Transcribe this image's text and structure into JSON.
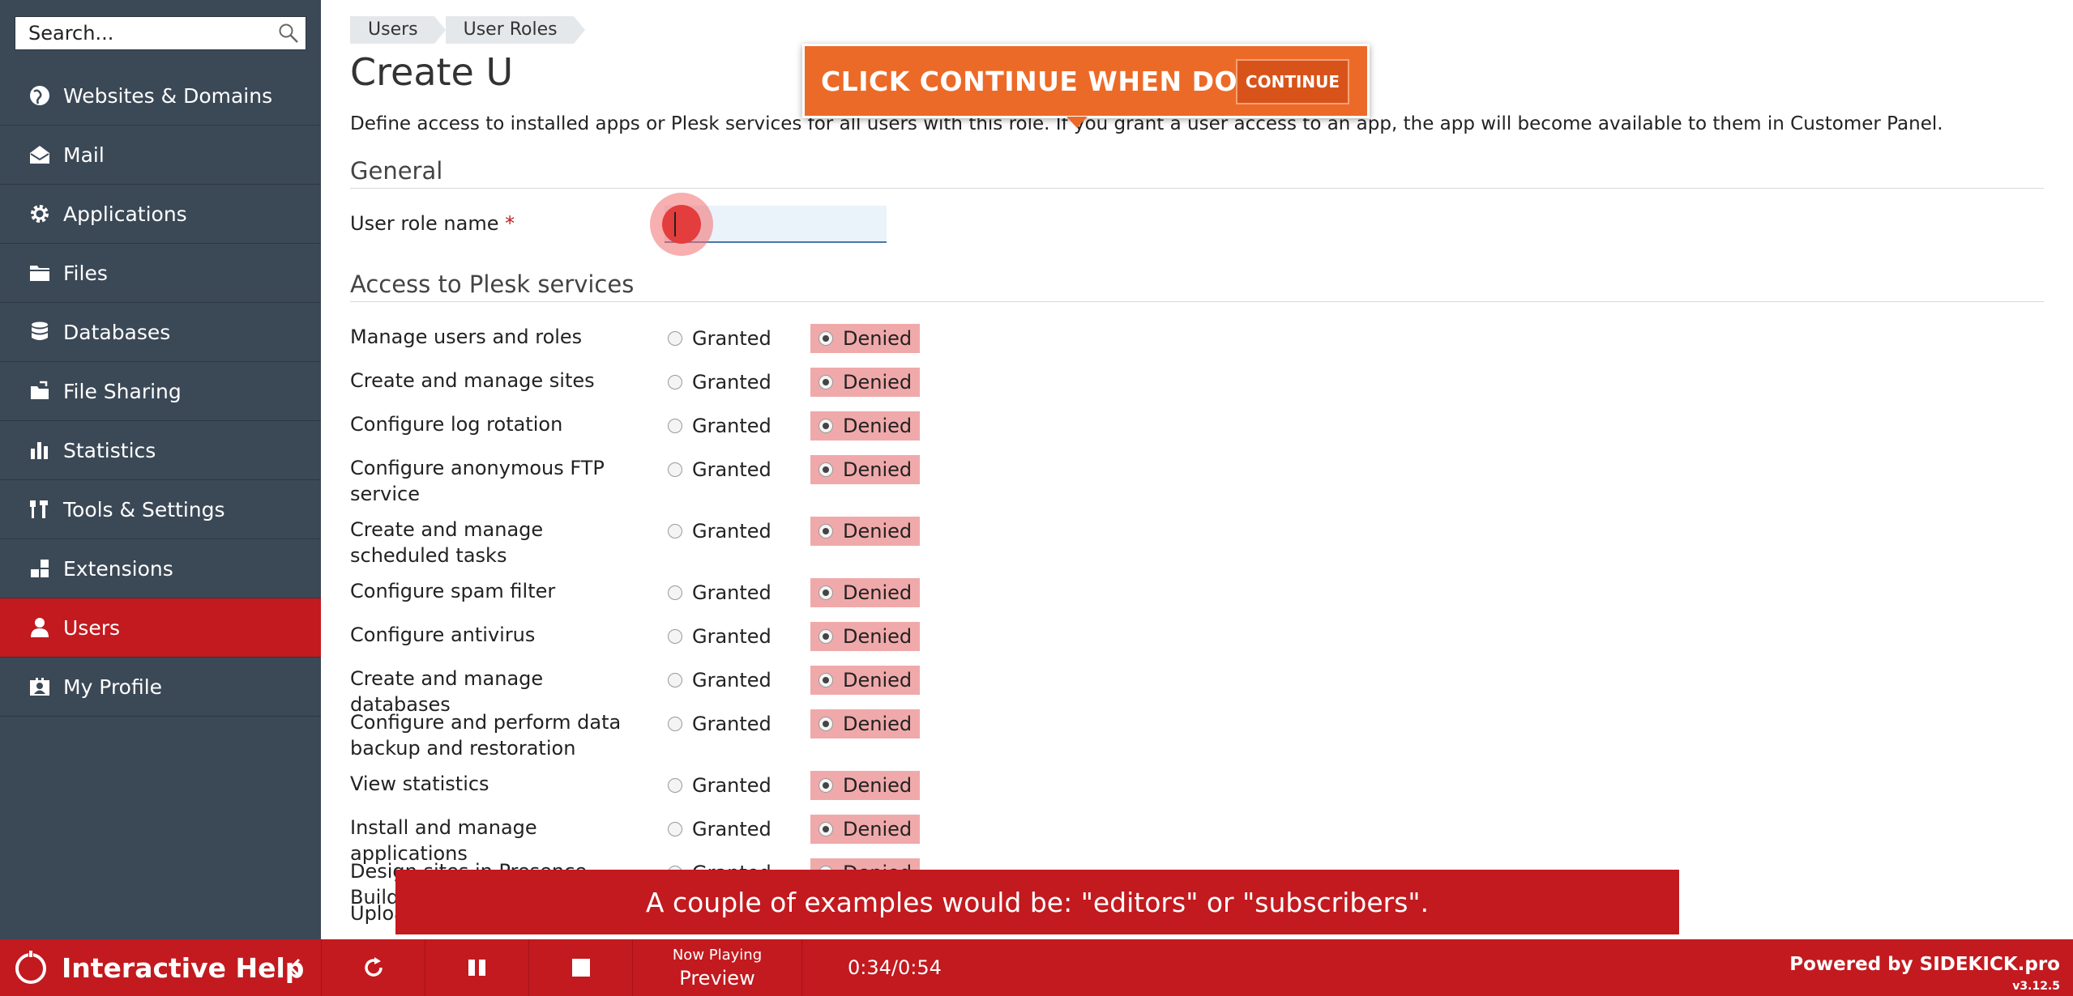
{
  "search": {
    "placeholder": "Search..."
  },
  "sidebar": {
    "items": [
      {
        "label": "Websites & Domains",
        "icon": "globe-icon"
      },
      {
        "label": "Mail",
        "icon": "mail-icon"
      },
      {
        "label": "Applications",
        "icon": "gear-icon"
      },
      {
        "label": "Files",
        "icon": "folder-icon"
      },
      {
        "label": "Databases",
        "icon": "database-icon"
      },
      {
        "label": "File Sharing",
        "icon": "file-sharing-icon"
      },
      {
        "label": "Statistics",
        "icon": "bar-chart-icon"
      },
      {
        "label": "Tools & Settings",
        "icon": "tools-icon"
      },
      {
        "label": "Extensions",
        "icon": "extensions-icon"
      },
      {
        "label": "Users",
        "icon": "user-icon",
        "active": true
      },
      {
        "label": "My Profile",
        "icon": "profile-icon"
      }
    ]
  },
  "breadcrumb": [
    "Users",
    "User Roles"
  ],
  "page": {
    "title": "Create U",
    "description": "Define access to installed apps or Plesk services for all users with this role. If you grant a user access to an app, the app will become available to them in Customer Panel."
  },
  "general": {
    "section_title": "General",
    "role_name_label": "User role name",
    "required_mark": "*",
    "role_name_value": ""
  },
  "access": {
    "section_title": "Access to Plesk services",
    "granted_label": "Granted",
    "denied_label": "Denied",
    "permissions": [
      {
        "label": "Manage users and roles",
        "value": "Denied"
      },
      {
        "label": "Create and manage sites",
        "value": "Denied"
      },
      {
        "label": "Configure log rotation",
        "value": "Denied"
      },
      {
        "label": "Configure anonymous FTP service",
        "value": "Denied"
      },
      {
        "label": "Create and manage scheduled tasks",
        "value": "Denied"
      },
      {
        "label": "Configure spam filter",
        "value": "Denied"
      },
      {
        "label": "Configure antivirus",
        "value": "Denied"
      },
      {
        "label": "Create and manage databases",
        "value": "Denied"
      },
      {
        "label": "Configure and perform data backup and restoration",
        "value": "Denied"
      },
      {
        "label": "View statistics",
        "value": "Denied"
      },
      {
        "label": "Install and manage applications",
        "value": "Denied"
      },
      {
        "label": "Design sites in Presence Builder",
        "value": "Denied"
      },
      {
        "label": "Uploa",
        "value": ""
      }
    ]
  },
  "callout": {
    "text": "CLICK CONTINUE WHEN DONE",
    "button_label": "CONTINUE"
  },
  "caption": {
    "text": "A couple of examples would be: \"editors\" or \"subscribers\"."
  },
  "player": {
    "title": "Interactive Help",
    "now_playing_label": "Now Playing",
    "now_playing_value": "Preview",
    "timer": "0:34/0:54",
    "powered_by": "Powered by SIDEKICK.pro",
    "version": "v3.12.5"
  },
  "colors": {
    "sidebar_bg": "#3b4856",
    "accent_red": "#c21a1f",
    "callout_orange": "#ec6a27",
    "denied_highlight": "#f0a9aa"
  }
}
